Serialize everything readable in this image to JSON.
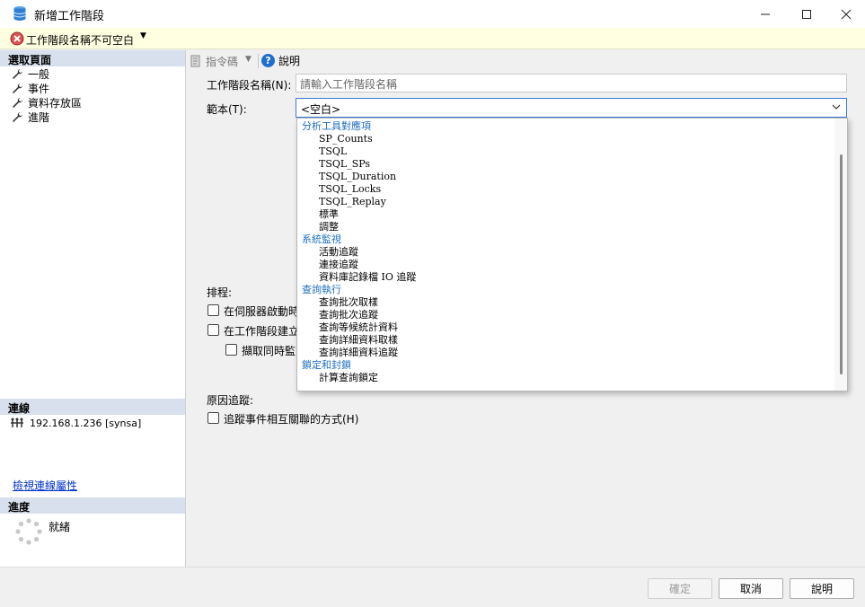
{
  "window": {
    "title": "新增工作階段",
    "controls": [
      "minimize",
      "maximize",
      "close"
    ]
  },
  "error_bar": {
    "message": "工作階段名稱不可空白"
  },
  "left_pane": {
    "select_page_header": "選取頁面",
    "pages": [
      {
        "label": "一般",
        "icon": "wrench-icon"
      },
      {
        "label": "事件",
        "icon": "wrench-icon"
      },
      {
        "label": "資料存放區",
        "icon": "wrench-icon"
      },
      {
        "label": "進階",
        "icon": "wrench-icon"
      }
    ],
    "connection_header": "連線",
    "connection_text": "192.168.1.236 [synsa]",
    "view_connection_props_link": "檢視連線屬性",
    "progress_header": "進度",
    "progress_status": "就緒"
  },
  "toolbar": {
    "script_label": "指令碼",
    "help_label": "說明"
  },
  "form": {
    "session_name_label": "工作階段名稱(N):",
    "session_name_placeholder": "請輸入工作階段名稱",
    "template_label": "範本(T):",
    "template_value": "<空白>",
    "schedule_label": "排程:",
    "schedule_option1": "在伺服器啟動時",
    "schedule_option2": "在工作階段建立",
    "schedule_option3": "擷取同時監",
    "causality_label": "原因追蹤:",
    "causality_option": "追蹤事件相互關聯的方式(H)"
  },
  "template_dropdown": {
    "rows": [
      {
        "text": "分析工具對應項",
        "group": true
      },
      {
        "text": "SP_Counts",
        "group": false
      },
      {
        "text": "TSQL",
        "group": false
      },
      {
        "text": "TSQL_SPs",
        "group": false
      },
      {
        "text": "TSQL_Duration",
        "group": false
      },
      {
        "text": "TSQL_Locks",
        "group": false
      },
      {
        "text": "TSQL_Replay",
        "group": false
      },
      {
        "text": "標準",
        "group": false
      },
      {
        "text": "調整",
        "group": false
      },
      {
        "text": "系統監視",
        "group": true
      },
      {
        "text": "活動追蹤",
        "group": false
      },
      {
        "text": "連接追蹤",
        "group": false
      },
      {
        "text": "資料庫記錄檔 IO 追蹤",
        "group": false
      },
      {
        "text": "查詢執行",
        "group": true
      },
      {
        "text": "查詢批次取樣",
        "group": false
      },
      {
        "text": "查詢批次追蹤",
        "group": false
      },
      {
        "text": "查詢等候統計資料",
        "group": false
      },
      {
        "text": "查詢詳細資料取樣",
        "group": false
      },
      {
        "text": "查詢詳細資料追蹤",
        "group": false
      },
      {
        "text": "鎖定和封鎖",
        "group": true
      },
      {
        "text": "計算查詢鎖定",
        "group": false
      }
    ]
  },
  "footer": {
    "ok_label": "確定",
    "cancel_label": "取消",
    "help_label": "說明"
  },
  "colors": {
    "error_bar_bg": "#ffffe1",
    "section_header_bg": "#d7e0ec",
    "group_text": "#1d6fc0",
    "link": "#0033cc",
    "combo_focus_border": "#3b7bd8"
  }
}
